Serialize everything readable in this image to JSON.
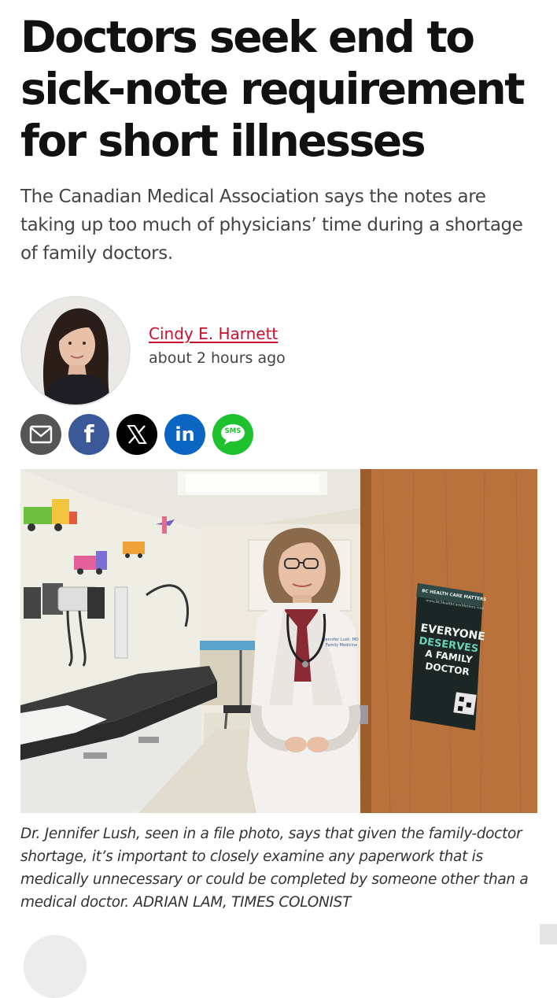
{
  "article": {
    "headline": "Doctors seek end to sick-note requirement for short illnesses",
    "dek": "The Canadian Medical Association says the notes are taking up too much of physicians’ time during a shortage of family doctors.",
    "author": "Cindy E. Harnett",
    "timestamp": "about 2 hours ago"
  },
  "share": {
    "buttons": [
      {
        "icon": "envelope-icon",
        "color": "#555555"
      },
      {
        "icon": "facebook-icon",
        "color": "#3b5998",
        "text": "f"
      },
      {
        "icon": "x-icon",
        "color": "#000000"
      },
      {
        "icon": "linkedin-icon",
        "color": "#0a66c2",
        "text": "in"
      },
      {
        "icon": "sms-icon",
        "color": "#1fc12f",
        "text": "SMS"
      }
    ]
  },
  "photo": {
    "poster": {
      "header": "BC HEALTH CARE MATTERS",
      "url": "www.BCHealthCareMatters.com",
      "line1": "EVERYONE",
      "line2": "DESERVES",
      "line3": "A FAMILY",
      "line4": "DOCTOR"
    },
    "coat_name": "Jennifer Lush, MD",
    "coat_dept": "Family Medicine"
  },
  "caption": "Dr. Jennifer Lush, seen in a file photo, says that given the family-doctor shortage, it’s important to closely examine any paperwork that is medically unnecessary or could be completed by someone other than a medical doctor. ADRIAN LAM, TIMES COLONIST",
  "colors": {
    "author_link": "#c8102e",
    "headline": "#111111",
    "dek": "#444444"
  }
}
